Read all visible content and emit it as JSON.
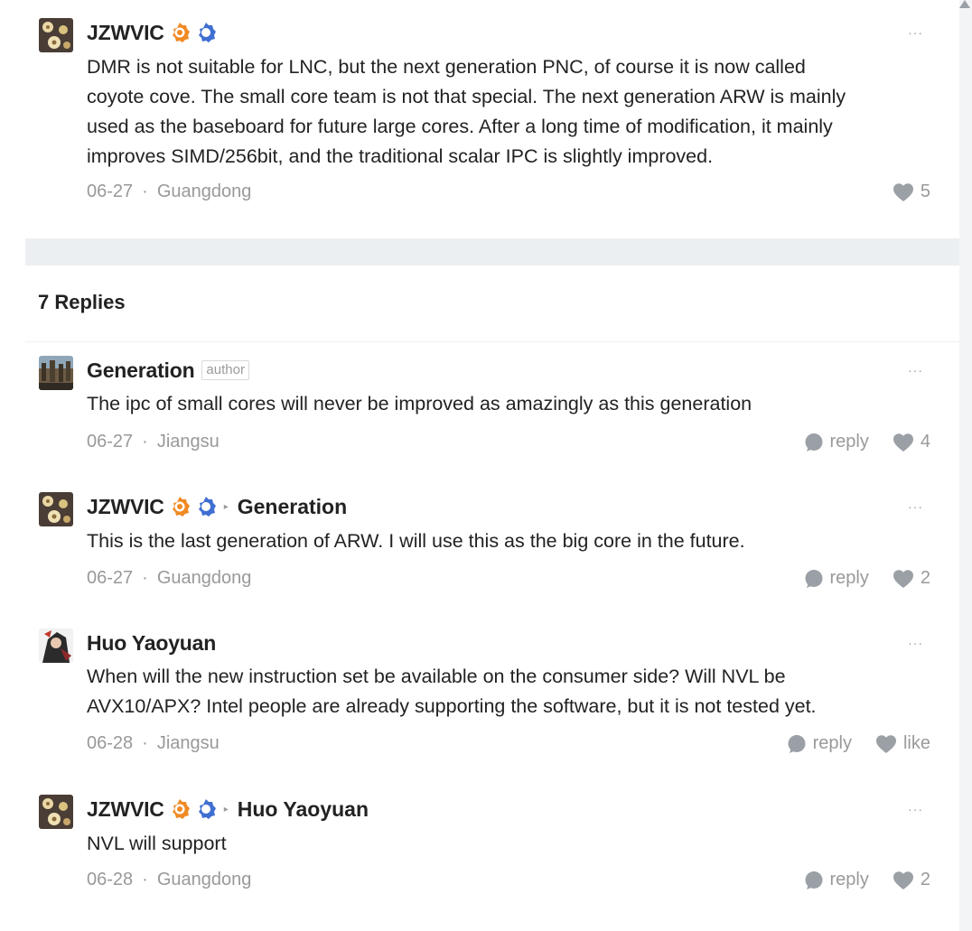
{
  "main_post": {
    "username": "JZWVIC",
    "text_lines": [
      "DMR is not suitable for LNC, but the next generation PNC, of course it is now called",
      "coyote cove. The small core team is not that special. The next generation ARW is mainly",
      "used as the baseboard for future large cores. After a long time of modification, it mainly",
      "improves SIMD/256bit, and the traditional scalar IPC is slightly improved."
    ],
    "date": "06-27",
    "location": "Guangdong",
    "likes": "5",
    "more": "···"
  },
  "replies_header": "7 Replies",
  "meta_separator": "·",
  "replies": [
    {
      "username": "Generation",
      "author_tag": "author",
      "text": "The ipc of small cores will never be improved as amazingly as this generation",
      "date": "06-27",
      "location": "Jiangsu",
      "reply_label": "reply",
      "likes": "4",
      "more": "···"
    },
    {
      "username": "JZWVIC",
      "reply_to": "Generation",
      "text": "This is the last generation of ARW. I will use this as the big core in the future.",
      "date": "06-27",
      "location": "Guangdong",
      "reply_label": "reply",
      "likes": "2",
      "more": "···"
    },
    {
      "username": "Huo Yaoyuan",
      "text_lines": [
        "When will the new instruction set be available on the consumer side? Will NVL be",
        "AVX10/APX? Intel people are already supporting the software, but it is not tested yet."
      ],
      "date": "06-28",
      "location": "Jiangsu",
      "reply_label": "reply",
      "likes": "like",
      "more": "···"
    },
    {
      "username": "JZWVIC",
      "reply_to": "Huo Yaoyuan",
      "text": "NVL will support",
      "date": "06-28",
      "location": "Guangdong",
      "reply_label": "reply",
      "likes": "2",
      "more": "···"
    }
  ],
  "colors": {
    "badge_orange": "#f08a24",
    "badge_blue": "#3f6fd1",
    "muted_text": "#999999",
    "divider": "#eceff2"
  },
  "icons": {
    "like": "heart-icon",
    "reply": "speech-bubble-icon",
    "level_badge": "orange-gear-badge-icon",
    "verified_badge": "blue-gear-badge-icon"
  }
}
